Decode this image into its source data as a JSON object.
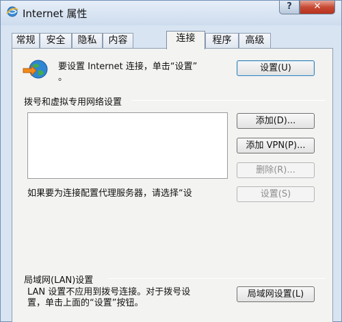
{
  "window": {
    "title": "Internet 属性",
    "help_label": "?",
    "close_label": "✕"
  },
  "tabs": [
    {
      "label": "常规"
    },
    {
      "label": "安全"
    },
    {
      "label": "隐私"
    },
    {
      "label": "内容"
    },
    {
      "label": "连接",
      "active": true
    },
    {
      "label": "程序"
    },
    {
      "label": "高级"
    }
  ],
  "setup": {
    "text_line1": "要设置 Internet 连接，单击“设置”",
    "text_line2": "。",
    "button": "设置(U)"
  },
  "dialup": {
    "heading": "拨号和虚拟专用网络设置",
    "add_button": "添加(D)...",
    "add_vpn_button": "添加 VPN(P)...",
    "delete_button": "删除(R)...",
    "proxy_text": "如果要为连接配置代理服务器，请选择“设",
    "settings_button": "设置(S)"
  },
  "lan": {
    "heading": "局域网(LAN)设置",
    "text_line1": "LAN 设置不应用到拨号连接。对于拨号设",
    "text_line2": "置，单击上面的“设置”按钮。",
    "button": "局域网设置(L)"
  },
  "colors": {
    "accent": "#3c7fb1",
    "close_red": "#c74a35"
  },
  "icons": {
    "title": "ie-globe-icon",
    "setup": "connect-wizard-globe-icon"
  }
}
